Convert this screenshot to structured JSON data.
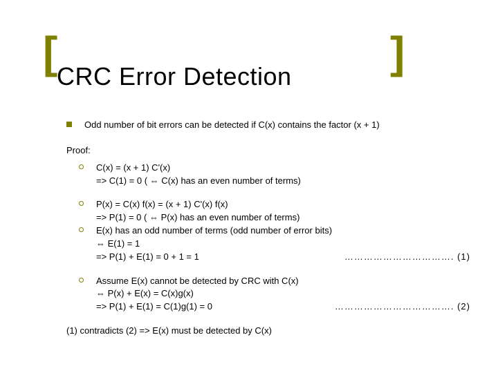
{
  "title": "CRC Error Detection",
  "main_bullet": "Odd number of bit errors can be detected if C(x) contains the factor (x + 1)",
  "proof_label": "Proof:",
  "block1": {
    "l1": "C(x) = (x + 1) C'(x)",
    "l2": "=> C(1) = 0 ( ⇔ C(x) has an even number of terms)"
  },
  "block2": {
    "l1": "P(x) = C(x) f(x) = (x + 1) C'(x) f(x)",
    "l2": "=> P(1) = 0 ( ⇔ P(x) has an even number of terms)",
    "l3": "E(x) has an odd number of terms (odd number of error bits)",
    "l4": "⇔ E(1) = 1",
    "l5_left": "=> P(1) + E(1) = 0 + 1 = 1",
    "l5_dots": "……………………………. (1)"
  },
  "block3": {
    "l1": "Assume E(x) cannot be detected by CRC with C(x)",
    "l2": "⇔ P(x) + E(x) = C(x)g(x)",
    "l3_left": "=> P(1) + E(1) = C(1)g(1) = 0",
    "l3_dots": "………………………………. (2)"
  },
  "conclusion": "(1) contradicts (2) => E(x) must be detected by C(x)",
  "brackets": {
    "left": "[",
    "right": "]"
  }
}
